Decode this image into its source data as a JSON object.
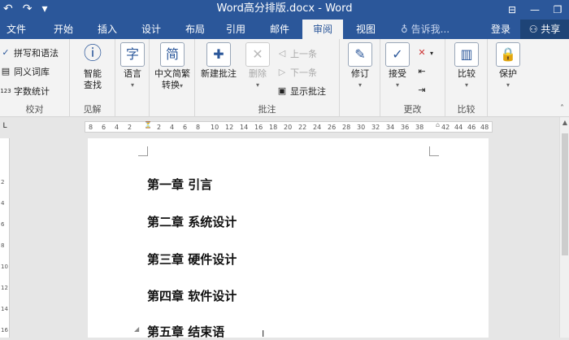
{
  "titlebar": {
    "title": "Word高分排版.docx - Word",
    "undo": "↶",
    "redo": "↷",
    "customize": "▾",
    "ribbon_opts": "⊟",
    "minimize": "—",
    "restore": "❐"
  },
  "tabs": [
    {
      "label": "文件"
    },
    {
      "label": "开始"
    },
    {
      "label": "插入"
    },
    {
      "label": "设计"
    },
    {
      "label": "布局"
    },
    {
      "label": "引用"
    },
    {
      "label": "邮件"
    },
    {
      "label": "审阅"
    },
    {
      "label": "视图"
    }
  ],
  "tell_me": "告诉我...",
  "login": "登录",
  "share": "共享",
  "ribbon": {
    "proofing": {
      "label": "校对",
      "spell": "拼写和语法",
      "thesaurus": "同义词库",
      "wordcount": "字数统计"
    },
    "insights": {
      "label": "见解",
      "smart": "智能",
      "smart2": "查找"
    },
    "language": {
      "label": "语言"
    },
    "chinese": {
      "label1": "中文简繁",
      "label2": "转换"
    },
    "comments": {
      "label": "批注",
      "new": "新建批注",
      "delete": "删除",
      "prev": "上一条",
      "next": "下一条",
      "show": "显示批注"
    },
    "tracking": {
      "label": "修订"
    },
    "changes": {
      "label": "更改",
      "accept": "接受"
    },
    "compare": {
      "label": "比较",
      "btn": "比较"
    },
    "protect": {
      "label": "保护"
    }
  },
  "ruler": {
    "h_ticks": [
      "8",
      "6",
      "4",
      "2",
      "2",
      "4",
      "6",
      "8",
      "10",
      "12",
      "14",
      "16",
      "18",
      "20",
      "22",
      "24",
      "26",
      "28",
      "30",
      "32",
      "34",
      "36",
      "38",
      "42",
      "44",
      "46",
      "48"
    ],
    "v_ticks": [
      "2",
      "4",
      "6",
      "8",
      "10",
      "12",
      "14",
      "16"
    ]
  },
  "document": {
    "headings": [
      "第一章  引言",
      "第二章  系统设计",
      "第三章  硬件设计",
      "第四章  软件设计",
      "第五章  结束语"
    ]
  }
}
